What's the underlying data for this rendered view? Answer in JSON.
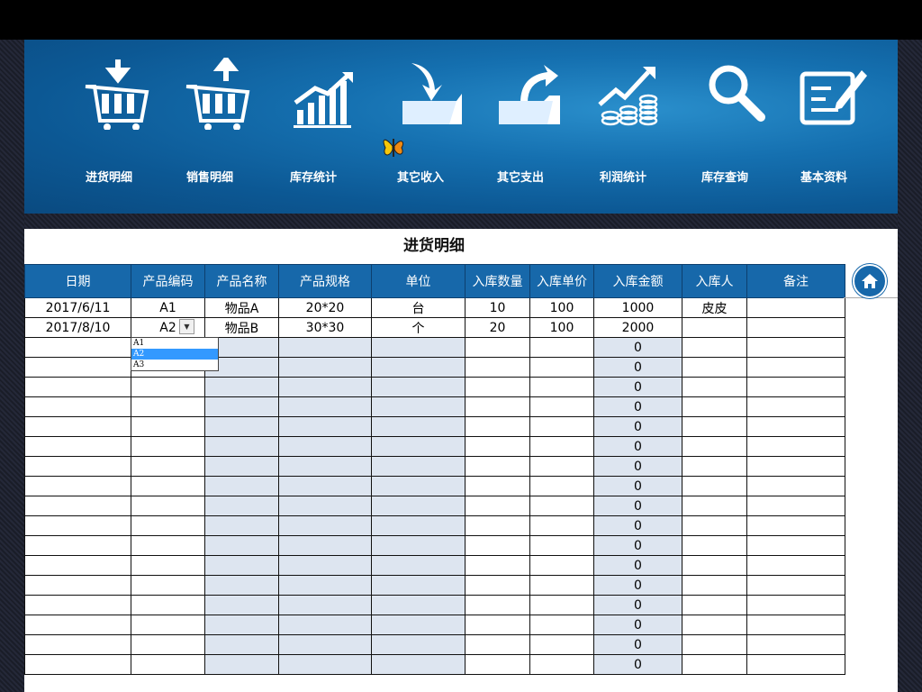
{
  "banner": {
    "nav": [
      {
        "label": "进货明细",
        "icon": "cart-down-icon"
      },
      {
        "label": "销售明细",
        "icon": "cart-up-icon"
      },
      {
        "label": "库存统计",
        "icon": "bar-chart-icon"
      },
      {
        "label": "其它收入",
        "icon": "folder-in-icon"
      },
      {
        "label": "其它支出",
        "icon": "folder-out-icon"
      },
      {
        "label": "利润统计",
        "icon": "profit-coins-icon"
      },
      {
        "label": "库存查询",
        "icon": "search-icon"
      },
      {
        "label": "基本资料",
        "icon": "edit-document-icon"
      }
    ]
  },
  "sheet": {
    "title": "进货明细",
    "headers": [
      "日期",
      "产品编码",
      "产品名称",
      "产品规格",
      "单位",
      "入库数量",
      "入库单价",
      "入库金额",
      "入库人",
      "备注"
    ],
    "rows": [
      [
        "2017/6/11",
        "A1",
        "物品A",
        "20*20",
        "台",
        "10",
        "100",
        "1000",
        "皮皮",
        ""
      ],
      [
        "2017/8/10",
        "A2",
        "物品B",
        "30*30",
        "个",
        "20",
        "100",
        "2000",
        "",
        ""
      ],
      [
        "",
        "",
        "",
        "",
        "",
        "",
        "",
        "0",
        "",
        ""
      ],
      [
        "",
        "",
        "",
        "",
        "",
        "",
        "",
        "0",
        "",
        ""
      ],
      [
        "",
        "",
        "",
        "",
        "",
        "",
        "",
        "0",
        "",
        ""
      ],
      [
        "",
        "",
        "",
        "",
        "",
        "",
        "",
        "0",
        "",
        ""
      ],
      [
        "",
        "",
        "",
        "",
        "",
        "",
        "",
        "0",
        "",
        ""
      ],
      [
        "",
        "",
        "",
        "",
        "",
        "",
        "",
        "0",
        "",
        ""
      ],
      [
        "",
        "",
        "",
        "",
        "",
        "",
        "",
        "0",
        "",
        ""
      ],
      [
        "",
        "",
        "",
        "",
        "",
        "",
        "",
        "0",
        "",
        ""
      ],
      [
        "",
        "",
        "",
        "",
        "",
        "",
        "",
        "0",
        "",
        ""
      ],
      [
        "",
        "",
        "",
        "",
        "",
        "",
        "",
        "0",
        "",
        ""
      ],
      [
        "",
        "",
        "",
        "",
        "",
        "",
        "",
        "0",
        "",
        ""
      ],
      [
        "",
        "",
        "",
        "",
        "",
        "",
        "",
        "0",
        "",
        ""
      ],
      [
        "",
        "",
        "",
        "",
        "",
        "",
        "",
        "0",
        "",
        ""
      ],
      [
        "",
        "",
        "",
        "",
        "",
        "",
        "",
        "0",
        "",
        ""
      ],
      [
        "",
        "",
        "",
        "",
        "",
        "",
        "",
        "0",
        "",
        ""
      ],
      [
        "",
        "",
        "",
        "",
        "",
        "",
        "",
        "0",
        "",
        ""
      ],
      [
        "",
        "",
        "",
        "",
        "",
        "",
        "",
        "0",
        "",
        ""
      ]
    ],
    "dropdown": {
      "options": [
        "A1",
        "A2",
        "A3"
      ],
      "selected": "A2"
    }
  },
  "colors": {
    "header_bg": "#1768aa",
    "shade": "#dde5f0",
    "banner": "#0c5894"
  }
}
